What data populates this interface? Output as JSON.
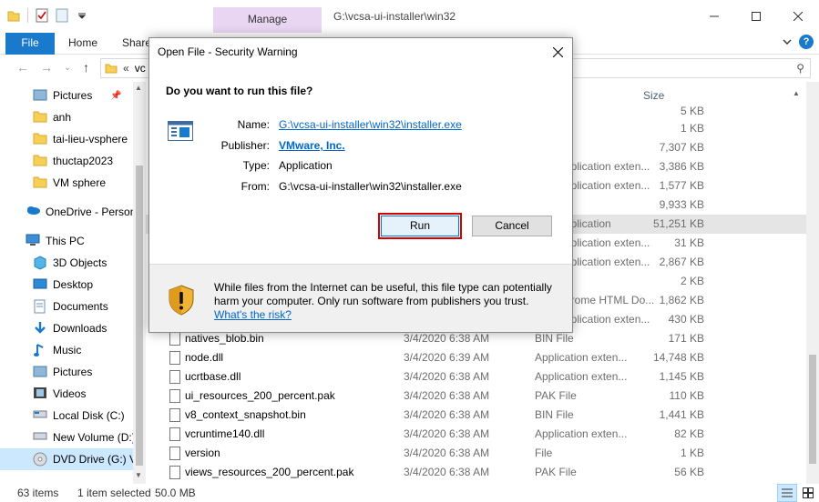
{
  "window": {
    "title_path": "G:\\vcsa-ui-installer\\win32",
    "contextual_tab": "Manage",
    "ribbon_tabs": [
      "File",
      "Home",
      "Share"
    ],
    "address_fragment": "vc"
  },
  "nav": {
    "items": [
      {
        "label": "Pictures",
        "icon": "pictures-icon",
        "pinned": true
      },
      {
        "label": "anh",
        "icon": "folder-icon"
      },
      {
        "label": "tai-lieu-vsphere",
        "icon": "folder-icon"
      },
      {
        "label": "thuctap2023",
        "icon": "folder-icon"
      },
      {
        "label": "VM sphere",
        "icon": "folder-icon"
      },
      {
        "label": "OneDrive - Person",
        "icon": "onedrive-icon"
      },
      {
        "label": "This PC",
        "icon": "computer-icon"
      },
      {
        "label": "3D Objects",
        "icon": "3d-objects-icon"
      },
      {
        "label": "Desktop",
        "icon": "desktop-icon"
      },
      {
        "label": "Documents",
        "icon": "documents-icon"
      },
      {
        "label": "Downloads",
        "icon": "downloads-icon"
      },
      {
        "label": "Music",
        "icon": "music-icon"
      },
      {
        "label": "Pictures",
        "icon": "pictures-icon"
      },
      {
        "label": "Videos",
        "icon": "videos-icon"
      },
      {
        "label": "Local Disk (C:)",
        "icon": "disk-icon"
      },
      {
        "label": "New Volume (D:)",
        "icon": "disk-icon"
      },
      {
        "label": "DVD Drive (G:) V",
        "icon": "dvd-icon",
        "selected": true
      }
    ]
  },
  "filelist": {
    "size_header": "Size",
    "partial_rows": [
      {
        "type": "",
        "size": "5 KB"
      },
      {
        "type": "",
        "size": "1 KB"
      },
      {
        "type": "",
        "size": "7,307 KB"
      },
      {
        "type": "pplication exten...",
        "size": "3,386 KB"
      },
      {
        "type": "pplication exten...",
        "size": "1,577 KB"
      },
      {
        "type": "",
        "size": "9,933 KB"
      },
      {
        "type": "pplication",
        "size": "51,251 KB",
        "selected": true
      },
      {
        "type": "pplication exten...",
        "size": "31 KB"
      },
      {
        "type": "pplication exten...",
        "size": "2,867 KB"
      },
      {
        "type": "",
        "size": "2 KB"
      },
      {
        "type": "hrome HTML Do...",
        "size": "1,862 KB"
      },
      {
        "type": "pplication exten...",
        "size": "430 KB"
      }
    ],
    "rows": [
      {
        "name": "natives_blob.bin",
        "date": "3/4/2020 6:38 AM",
        "type": "BIN File",
        "size": "171 KB"
      },
      {
        "name": "node.dll",
        "date": "3/4/2020 6:39 AM",
        "type": "Application exten...",
        "size": "14,748 KB"
      },
      {
        "name": "ucrtbase.dll",
        "date": "3/4/2020 6:38 AM",
        "type": "Application exten...",
        "size": "1,145 KB"
      },
      {
        "name": "ui_resources_200_percent.pak",
        "date": "3/4/2020 6:38 AM",
        "type": "PAK File",
        "size": "110 KB"
      },
      {
        "name": "v8_context_snapshot.bin",
        "date": "3/4/2020 6:38 AM",
        "type": "BIN File",
        "size": "1,441 KB"
      },
      {
        "name": "vcruntime140.dll",
        "date": "3/4/2020 6:38 AM",
        "type": "Application exten...",
        "size": "82 KB"
      },
      {
        "name": "version",
        "date": "3/4/2020 6:38 AM",
        "type": "File",
        "size": "1 KB"
      },
      {
        "name": "views_resources_200_percent.pak",
        "date": "3/4/2020 6:38 AM",
        "type": "PAK File",
        "size": "56 KB"
      }
    ]
  },
  "status": {
    "count": "63 items",
    "selection": "1 item selected",
    "size": "50.0 MB"
  },
  "dialog": {
    "title": "Open File - Security Warning",
    "question": "Do you want to run this file?",
    "name_label": "Name:",
    "name_value": "G:\\vcsa-ui-installer\\win32\\installer.exe",
    "publisher_label": "Publisher:",
    "publisher_value": "VMware, Inc.",
    "type_label": "Type:",
    "type_value": "Application",
    "from_label": "From:",
    "from_value": "G:\\vcsa-ui-installer\\win32\\installer.exe",
    "run_label": "Run",
    "cancel_label": "Cancel",
    "warning_text": "While files from the Internet can be useful, this file type can potentially harm your computer. Only run software from publishers you trust.",
    "risk_link": "What's the risk?"
  },
  "colors": {
    "accent": "#1979ca",
    "manage_tab": "#e8d6f3",
    "link": "#0066cc",
    "highlight_border": "#d40000",
    "selection": "#cce8ff"
  }
}
